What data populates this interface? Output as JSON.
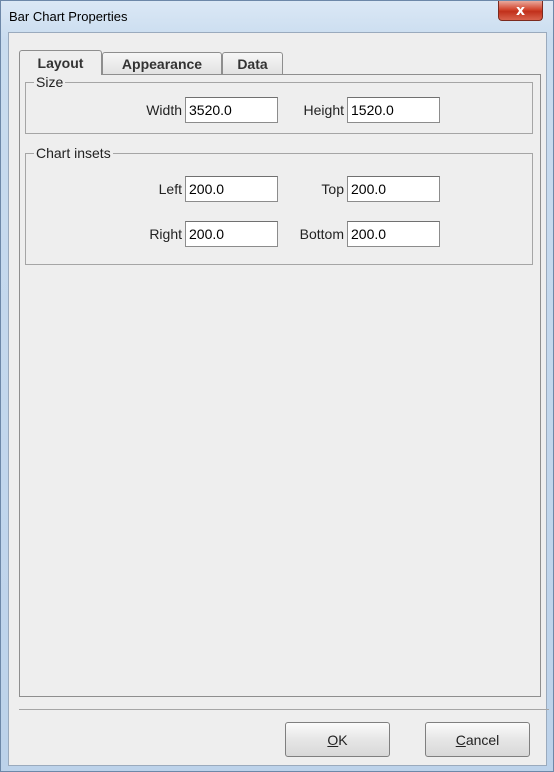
{
  "window": {
    "title": "Bar Chart Properties",
    "close_glyph": "x"
  },
  "tabs": [
    {
      "label": "Layout",
      "active": true
    },
    {
      "label": "Appearance",
      "active": false
    },
    {
      "label": "Data",
      "active": false
    }
  ],
  "size_group": {
    "legend": "Size",
    "width_label": "Width",
    "width_value": "3520.0",
    "height_label": "Height",
    "height_value": "1520.0"
  },
  "insets_group": {
    "legend": "Chart insets",
    "left_label": "Left",
    "left_value": "200.0",
    "top_label": "Top",
    "top_value": "200.0",
    "right_label": "Right",
    "right_value": "200.0",
    "bottom_label": "Bottom",
    "bottom_value": "200.0"
  },
  "buttons": {
    "ok_mnemonic": "O",
    "ok_rest": "K",
    "cancel_mnemonic": "C",
    "cancel_rest": "ancel"
  },
  "colors": {
    "titlebar": "#c9dcef",
    "close_button": "#c1301b",
    "panel_background": "#eeeeee"
  }
}
